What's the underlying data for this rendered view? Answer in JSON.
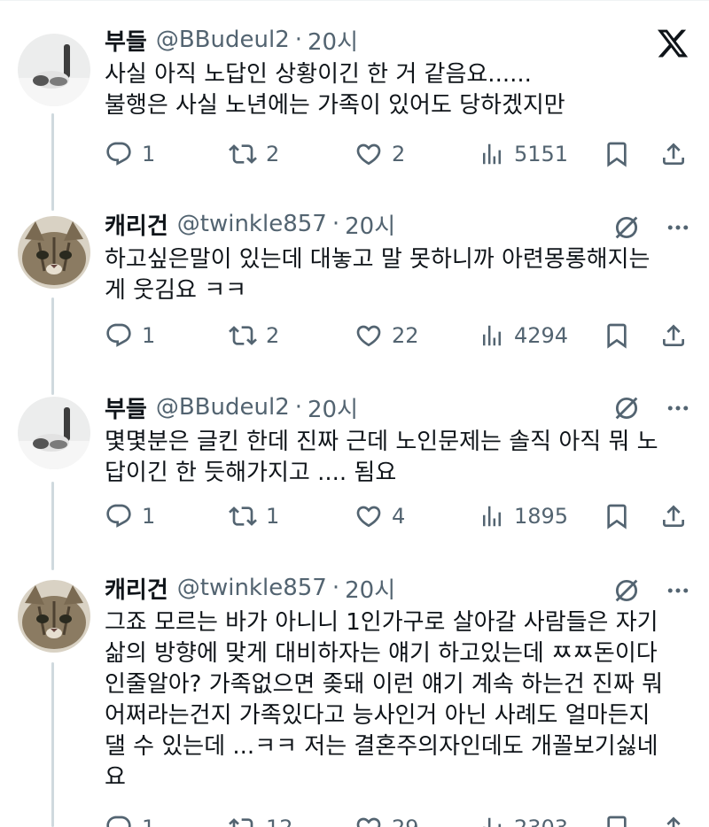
{
  "brand": {
    "logo_glyph": "𝕏",
    "accent": "#536471",
    "thread_line": "#cfd9de"
  },
  "icons": {
    "reply": "reply-icon",
    "retweet": "retweet-icon",
    "like": "heart-icon",
    "views": "views-icon",
    "bookmark": "bookmark-icon",
    "share": "share-icon",
    "more": "more-icon",
    "hidden": "slash-icon"
  },
  "tweets": [
    {
      "name": "부들",
      "handle": "@BBudeul2",
      "dot": "·",
      "time": "20시",
      "text": "사실 아직 노답인 상황이긴 한 거 같음요......\n불행은 사실 노년에는 가족이 있어도 당하겠지만",
      "replies": "1",
      "retweets": "2",
      "likes": "2",
      "views": "5151"
    },
    {
      "name": "캐리건",
      "handle": "@twinkle857",
      "dot": "·",
      "time": "20시",
      "text": "하고싶은말이 있는데 대놓고 말 못하니까 아련몽롱해지는\n게 웃김요 ㅋㅋ",
      "replies": "1",
      "retweets": "2",
      "likes": "22",
      "views": "4294"
    },
    {
      "name": "부들",
      "handle": "@BBudeul2",
      "dot": "·",
      "time": "20시",
      "text": "몇몇분은 글킨 한데 진짜 근데 노인문제는 솔직 아직 뭐 노\n답이긴 한 듯해가지고 .... 됨요",
      "replies": "1",
      "retweets": "1",
      "likes": "4",
      "views": "1895"
    },
    {
      "name": "캐리건",
      "handle": "@twinkle857",
      "dot": "·",
      "time": "20시",
      "text": "그죠 모르는 바가 아니니 1인가구로 살아갈 사람들은 자기\n삶의 방향에 맞게 대비하자는 얘기 하고있는데 ㅉㅉ돈이다\n인줄알아? 가족없으면 좆돼 이런 얘기 계속 하는건 진짜 뭐\n어쩌라는건지 가족있다고 능사인거 아닌 사례도 얼마든지\n댈 수 있는데 ...ㅋㅋ 저는 결혼주의자인데도 개꼴보기싫네\n요",
      "replies": "1",
      "retweets": "12",
      "likes": "29",
      "views": "2303"
    }
  ]
}
